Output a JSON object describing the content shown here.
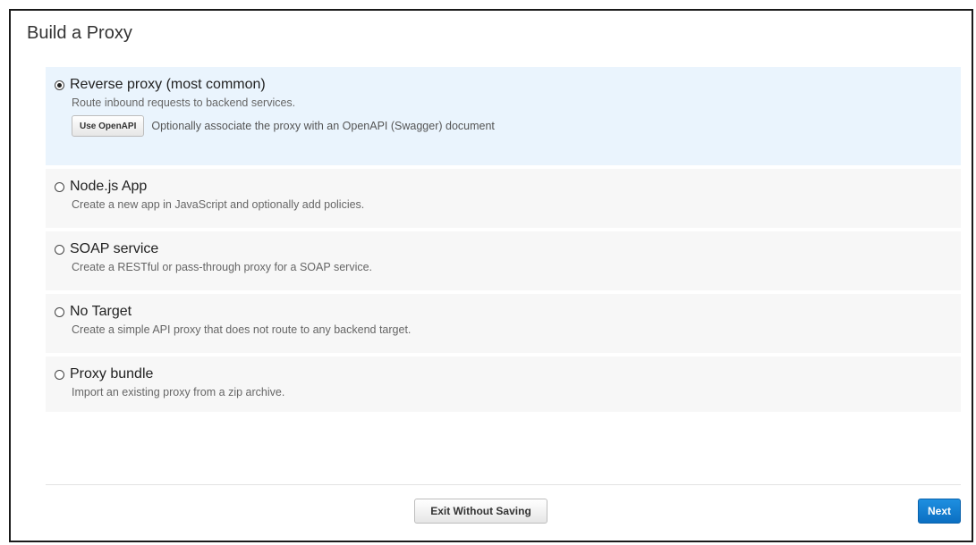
{
  "page": {
    "title": "Build a Proxy"
  },
  "options": [
    {
      "title": "Reverse proxy (most common)",
      "description": "Route inbound requests to backend services.",
      "selected": true,
      "openapi_button": "Use OpenAPI",
      "openapi_text": "Optionally associate the proxy with an OpenAPI (Swagger) document"
    },
    {
      "title": "Node.js App",
      "description": "Create a new app in JavaScript and optionally add policies.",
      "selected": false
    },
    {
      "title": "SOAP service",
      "description": "Create a RESTful or pass-through proxy for a SOAP service.",
      "selected": false
    },
    {
      "title": "No Target",
      "description": "Create a simple API proxy that does not route to any backend target.",
      "selected": false
    },
    {
      "title": "Proxy bundle",
      "description": "Import an existing proxy from a zip archive.",
      "selected": false
    }
  ],
  "footer": {
    "exit_label": "Exit Without Saving",
    "next_label": "Next"
  },
  "colors": {
    "selected_bg": "#eaf4fd",
    "option_bg": "#f7f7f7",
    "primary_button": "#1a86d9"
  }
}
